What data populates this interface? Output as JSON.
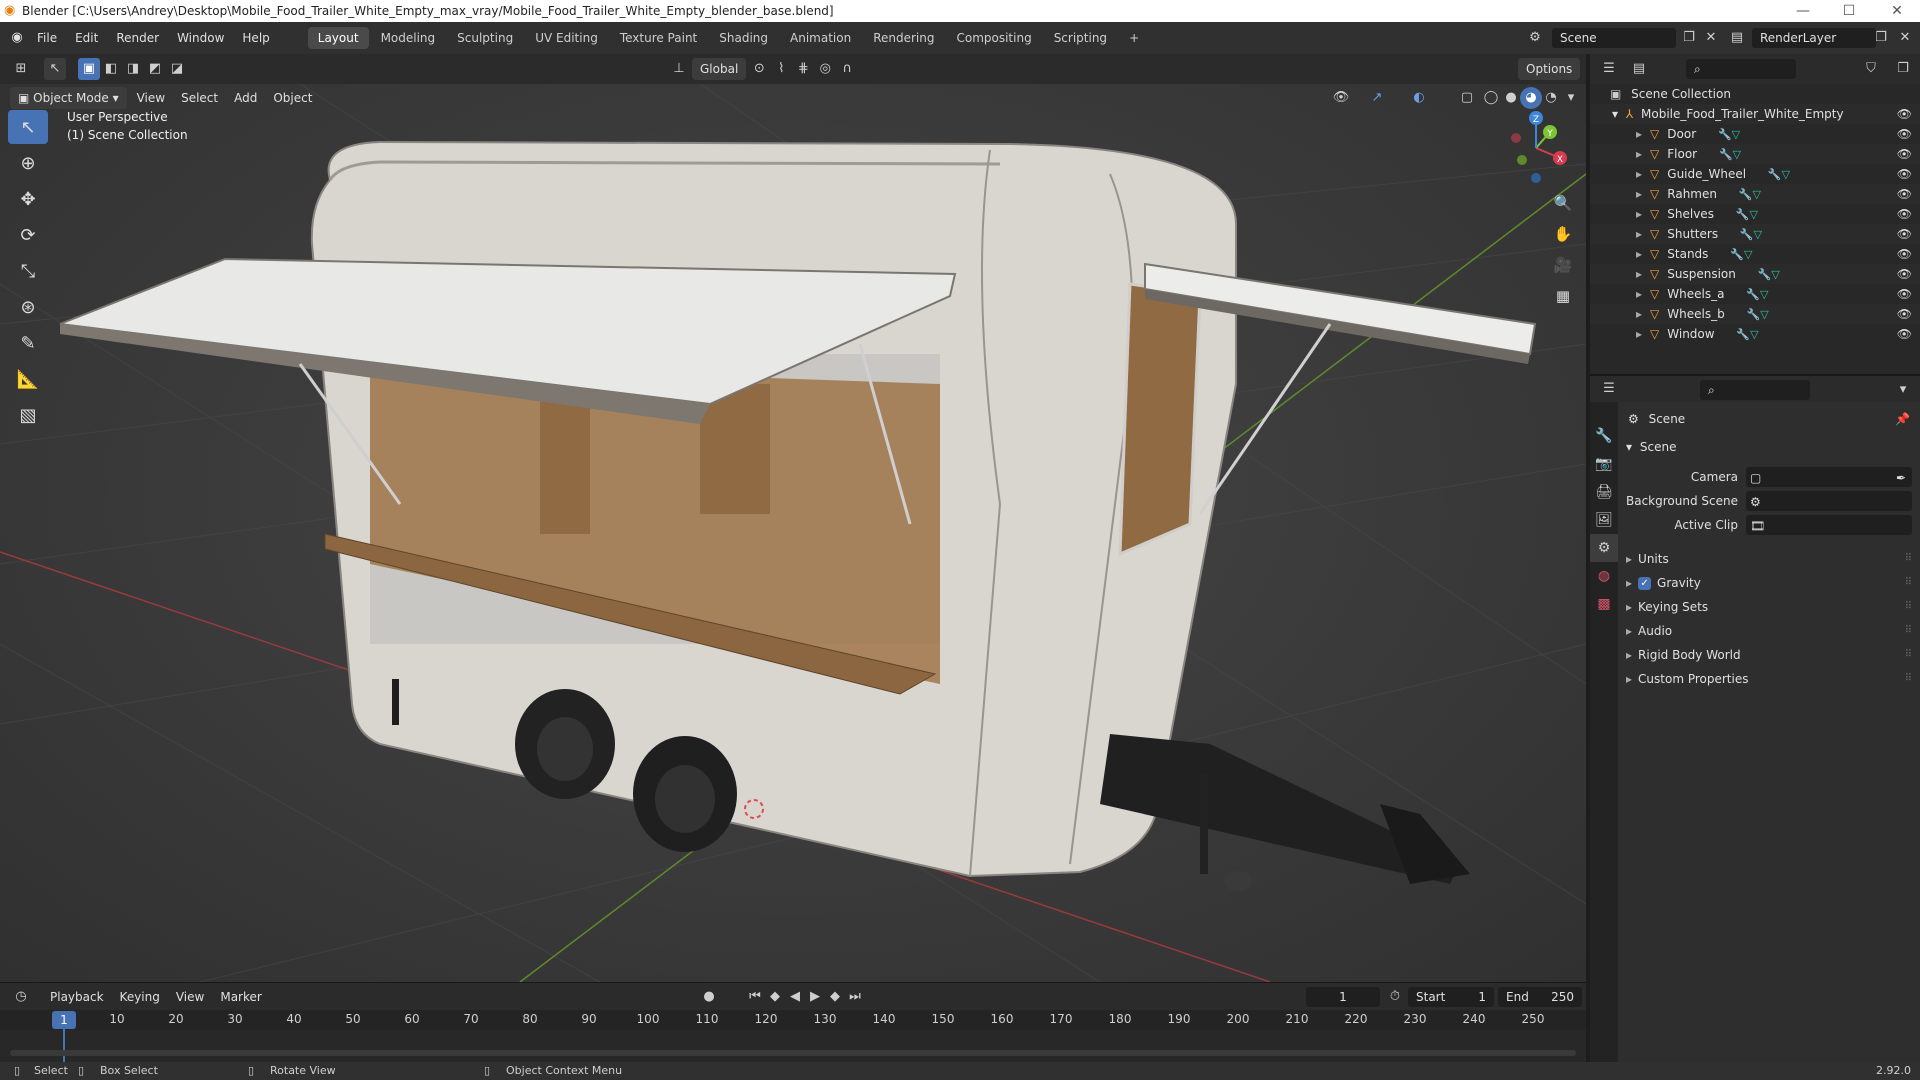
{
  "window": {
    "title": "Blender [C:\\Users\\Andrey\\Desktop\\Mobile_Food_Trailer_White_Empty_max_vray/Mobile_Food_Trailer_White_Empty_blender_base.blend]",
    "minimize": "—",
    "maximize": "☐",
    "close": "✕"
  },
  "menu": {
    "items": [
      "File",
      "Edit",
      "Render",
      "Window",
      "Help"
    ]
  },
  "workspaces": {
    "tabs": [
      "Layout",
      "Modeling",
      "Sculpting",
      "UV Editing",
      "Texture Paint",
      "Shading",
      "Animation",
      "Rendering",
      "Compositing",
      "Scripting"
    ],
    "active": "Layout",
    "add": "+"
  },
  "scene_selector": {
    "value": "Scene"
  },
  "layer_selector": {
    "value": "RenderLayer"
  },
  "viewport_header": {
    "transform_orientation": "Global",
    "options": "Options",
    "mode": "Object Mode",
    "menus": [
      "View",
      "Select",
      "Add",
      "Object"
    ]
  },
  "viewport": {
    "perspective": "User Perspective",
    "collection": "(1) Scene Collection",
    "gizmo": {
      "x": "X",
      "y": "Y",
      "z": "Z"
    }
  },
  "outliner": {
    "root": "Scene Collection",
    "collection": "Mobile_Food_Trailer_White_Empty",
    "objects": [
      "Door",
      "Floor",
      "Guide_Wheel",
      "Rahmen",
      "Shelves",
      "Shutters",
      "Stands",
      "Suspension",
      "Wheels_a",
      "Wheels_b",
      "Window"
    ]
  },
  "properties": {
    "context": "Scene",
    "panel": "Scene",
    "fields": [
      {
        "label": "Camera"
      },
      {
        "label": "Background Scene"
      },
      {
        "label": "Active Clip"
      }
    ],
    "subpanels": [
      "Units",
      "Gravity",
      "Keying Sets",
      "Audio",
      "Rigid Body World",
      "Custom Properties"
    ],
    "gravity_checked": true
  },
  "timeline": {
    "menus": [
      "Playback",
      "Keying",
      "View",
      "Marker"
    ],
    "current_frame": "1",
    "start_label": "Start",
    "start": "1",
    "end_label": "End",
    "end": "250",
    "ticks": [
      "10",
      "20",
      "30",
      "40",
      "50",
      "60",
      "70",
      "80",
      "90",
      "100",
      "110",
      "120",
      "130",
      "140",
      "150",
      "160",
      "170",
      "180",
      "190",
      "200",
      "210",
      "220",
      "230",
      "240",
      "250"
    ],
    "playhead": "1"
  },
  "statusbar": {
    "select": "Select",
    "box_select": "Box Select",
    "rotate_view": "Rotate View",
    "context_menu": "Object Context Menu",
    "version": "2.92.0"
  },
  "colors": {
    "accent": "#4772b3",
    "object_icon": "#f0a03c",
    "modifier_icon": "#6b9fe4",
    "mesh_icon": "#28c4a0",
    "x_axis": "#d63c4f",
    "y_axis": "#7cc432",
    "z_axis": "#3f86d9"
  }
}
